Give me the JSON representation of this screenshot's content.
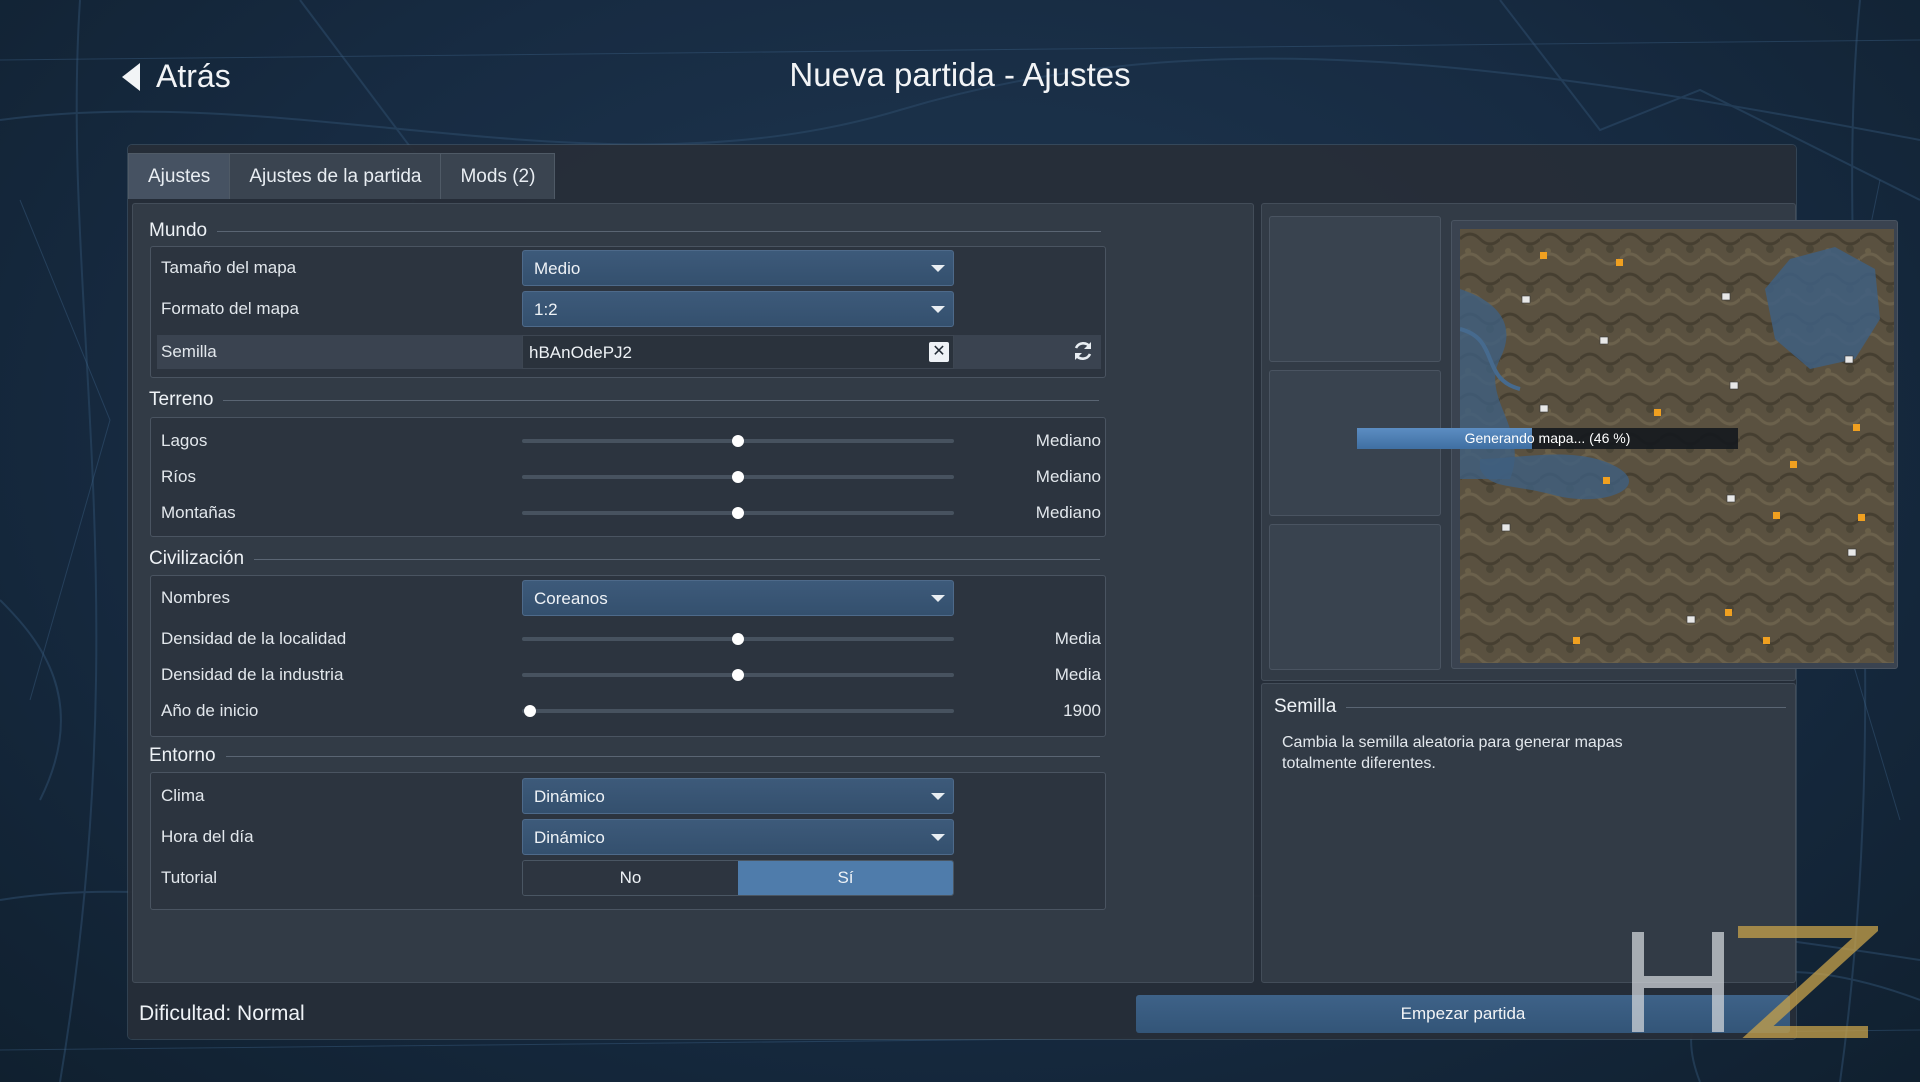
{
  "header": {
    "back_label": "Atrás",
    "title": "Nueva partida - Ajustes"
  },
  "tabs": [
    {
      "label": "Ajustes",
      "active": true
    },
    {
      "label": "Ajustes de la partida",
      "active": false
    },
    {
      "label": "Mods (2)",
      "active": false
    }
  ],
  "mundo": {
    "title": "Mundo",
    "map_size": {
      "label": "Tamaño del mapa",
      "value": "Medio"
    },
    "map_format": {
      "label": "Formato del mapa",
      "value": "1:2"
    },
    "seed": {
      "label": "Semilla",
      "value": "hBAnOdePJ2",
      "clear_icon": "close-icon",
      "refresh_icon": "refresh-icon"
    }
  },
  "terreno": {
    "title": "Terreno",
    "items": [
      {
        "label": "Lagos",
        "value_text": "Mediano",
        "level": 0.5
      },
      {
        "label": "Ríos",
        "value_text": "Mediano",
        "level": 0.5
      },
      {
        "label": "Montañas",
        "value_text": "Mediano",
        "level": 0.5
      }
    ]
  },
  "civilizacion": {
    "title": "Civilización",
    "names": {
      "label": "Nombres",
      "value": "Coreanos"
    },
    "town_density": {
      "label": "Densidad de la localidad",
      "value_text": "Media",
      "level": 0.5
    },
    "industry_density": {
      "label": "Densidad de la industria",
      "value_text": "Media",
      "level": 0.5
    },
    "start_year": {
      "label": "Año de inicio",
      "value_text": "1900",
      "level": 0.0
    }
  },
  "entorno": {
    "title": "Entorno",
    "climate": {
      "label": "Clima",
      "value": "Dinámico"
    },
    "time_of_day": {
      "label": "Hora del día",
      "value": "Dinámico"
    },
    "tutorial": {
      "label": "Tutorial",
      "options": [
        "No",
        "Sí"
      ],
      "selected": "Sí"
    }
  },
  "preview": {
    "progress_text": "Generando mapa... (46 %)",
    "progress": 0.46
  },
  "info": {
    "title": "Semilla",
    "text": "Cambia la semilla aleatoria para generar mapas totalmente diferentes."
  },
  "footer": {
    "difficulty": "Dificultad: Normal",
    "start_button": "Empezar partida"
  },
  "colors": {
    "accent": "#4f7cab",
    "dropdown": "#3a5676",
    "panel": "#323b46",
    "industry_marker": "#f0a020"
  }
}
